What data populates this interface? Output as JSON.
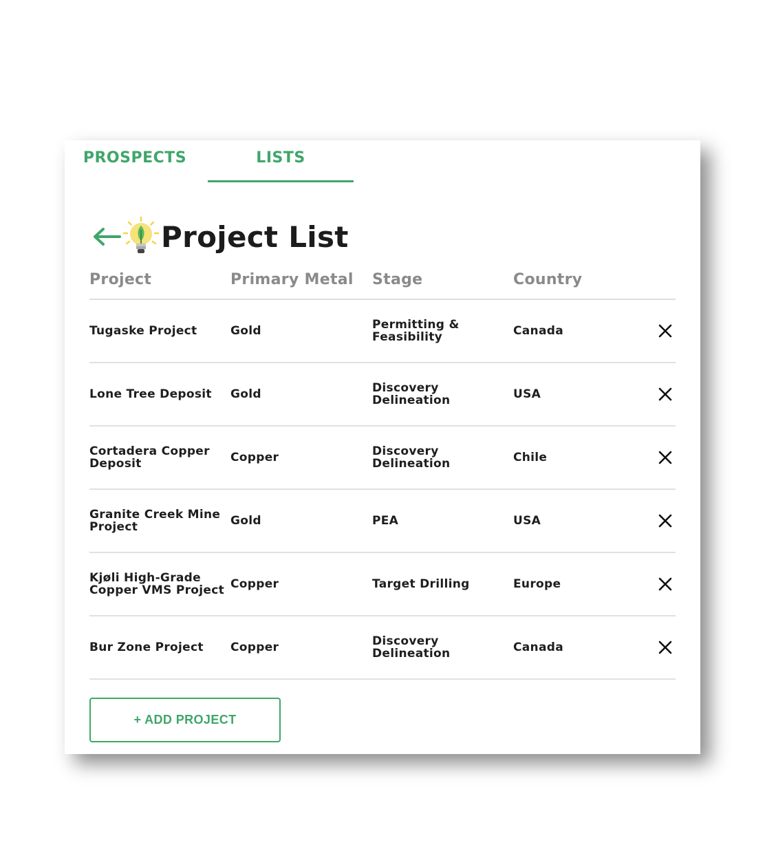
{
  "tabs": [
    {
      "label": "PROSPECTS",
      "active": false
    },
    {
      "label": "LISTS",
      "active": true
    }
  ],
  "header": {
    "back_icon": "arrow-left-icon",
    "emoji_icon": "lightbulb-icon",
    "title": "Project List"
  },
  "table": {
    "columns": [
      "Project",
      "Primary Metal",
      "Stage",
      "Country"
    ],
    "rows": [
      {
        "project": "Tugaske Project",
        "metal": "Gold",
        "stage": "Permitting & Feasibility",
        "country": "Canada"
      },
      {
        "project": "Lone Tree Deposit",
        "metal": "Gold",
        "stage": "Discovery Delineation",
        "country": "USA"
      },
      {
        "project": "Cortadera Copper Deposit",
        "metal": "Copper",
        "stage": "Discovery Delineation",
        "country": "Chile"
      },
      {
        "project": "Granite Creek Mine Project",
        "metal": "Gold",
        "stage": "PEA",
        "country": "USA"
      },
      {
        "project": "Kjøli High-Grade Copper VMS Project",
        "metal": "Copper",
        "stage": "Target Drilling",
        "country": "Europe"
      },
      {
        "project": "Bur Zone Project",
        "metal": "Copper",
        "stage": "Discovery Delineation",
        "country": "Canada"
      }
    ],
    "remove_icon": "close-icon"
  },
  "add_button": {
    "label": "+ ADD PROJECT"
  },
  "colors": {
    "accent": "#3fa66a",
    "text": "#1e1e1e",
    "header_text": "#8a8a8a",
    "divider": "#e1e1e1"
  }
}
